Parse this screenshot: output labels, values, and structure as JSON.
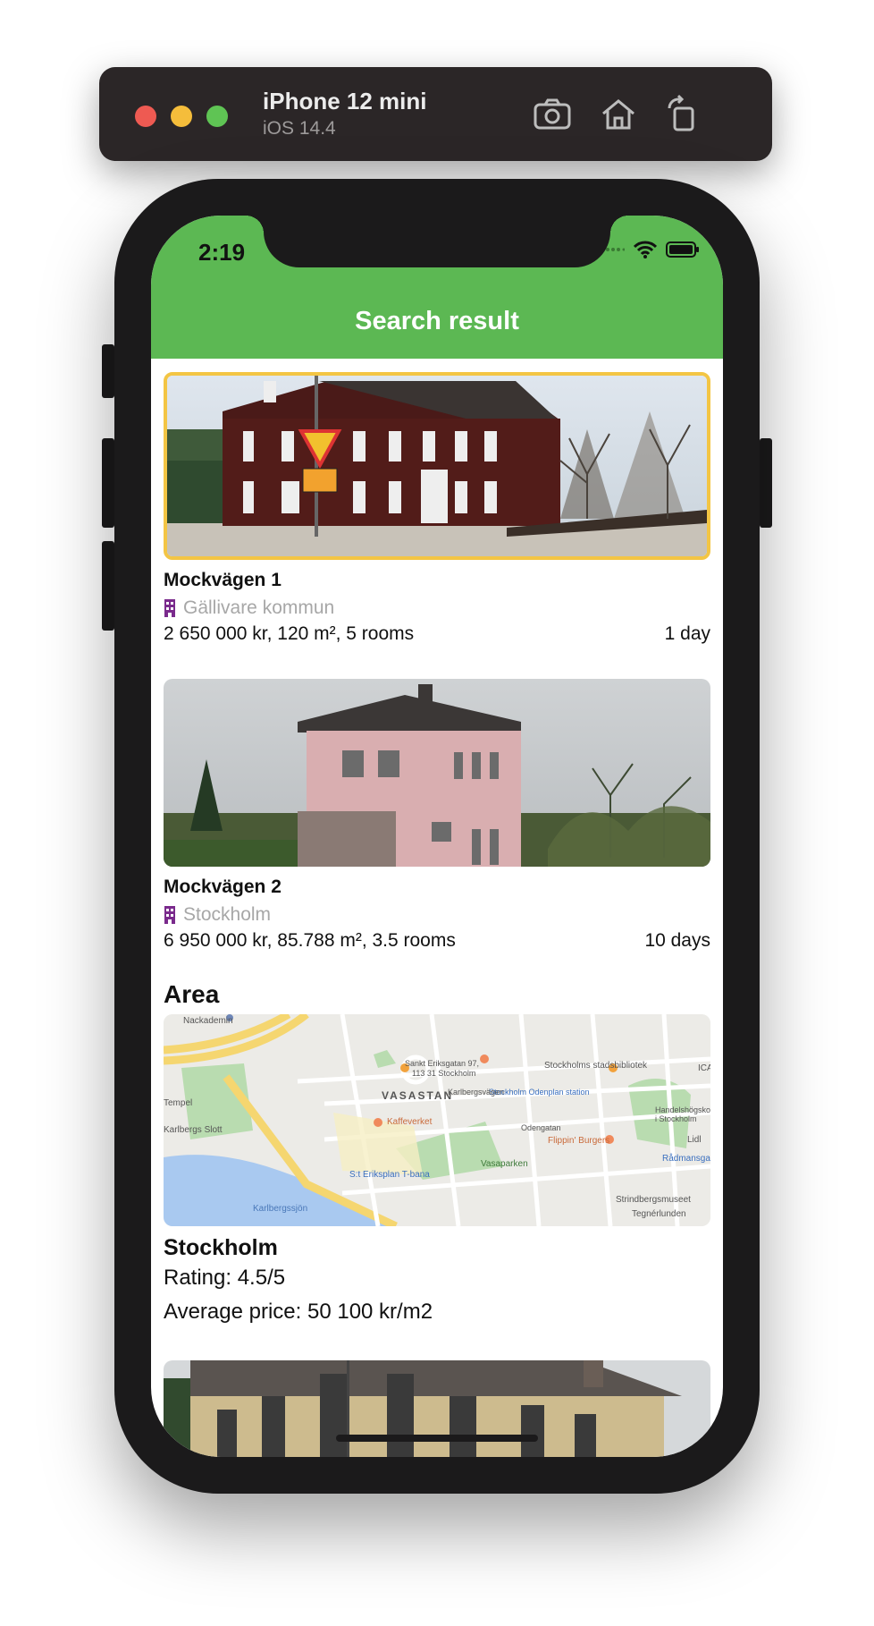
{
  "simulator": {
    "device_name": "iPhone 12 mini",
    "os_version": "iOS 14.4",
    "buttons": [
      "screenshot-icon",
      "home-icon",
      "rotate-icon"
    ]
  },
  "status_bar": {
    "time": "2:19"
  },
  "nav": {
    "title": "Search result"
  },
  "listings": [
    {
      "address": "Mockvägen 1",
      "municipality": "Gällivare kommun",
      "details": "2 650 000 kr, 120 m², 5 rooms",
      "age": "1 day",
      "selected": true
    },
    {
      "address": "Mockvägen 2",
      "municipality": "Stockholm",
      "details": "6 950 000 kr, 85.788 m², 3.5 rooms",
      "age": "10 days",
      "selected": false
    }
  ],
  "area": {
    "heading": "Area",
    "name": "Stockholm",
    "rating": "Rating: 4.5/5",
    "average_price": "Average price: 50 100 kr/m2",
    "map_labels": {
      "nackademin": "Nackademin",
      "vasastan": "VASASTAN",
      "sankt_eriksgatan": "Sankt Eriksgatan 97,",
      "sankt_eriksgatan_2": "113 31 Stockholm",
      "stadsbibliotek": "Stockholms stadsbibliotek",
      "odenplan": "Stockholm Odenplan station",
      "kaffeverket": "Kaffeverket",
      "flippin": "Flippin' Burgers",
      "vasaparken": "Vasaparken",
      "karlbergs_slott": "Karlbergs Slott",
      "st_eriksplan": "S:t Eriksplan T-bana",
      "karlbergssjon": "Karlbergssjön",
      "strindbergsmuseet": "Strindbergsmuseet",
      "tegnerlunden": "Tegnérlunden",
      "handelshogskolan": "Handelshögskol i Stockholm",
      "radmansgatan": "Rådmansgata",
      "lidl": "Lidl",
      "tempel": "Tempel",
      "odengatan": "Odengatan",
      "karlbergsvagen": "Karlbergsvägen",
      "ica": "ICA"
    }
  },
  "colors": {
    "header_green": "#5cb853",
    "selection_border": "#f3c544",
    "building_icon": "#7a2a8c"
  }
}
